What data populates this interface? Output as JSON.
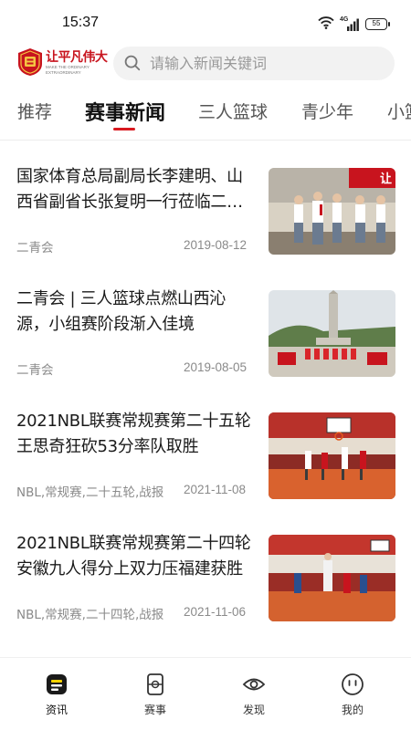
{
  "status_bar": {
    "time": "15:37",
    "network": "4G",
    "battery": "55",
    "icons": [
      "wifi-icon",
      "cellular-signal-icon",
      "battery-icon"
    ]
  },
  "header": {
    "logo_text": "让平凡伟大",
    "logo_subtitle_line1": "MAKE THE ORDINARY",
    "logo_subtitle_line2": "EXTRAORDINARY",
    "search": {
      "placeholder": "请输入新闻关键词",
      "icon": "search-icon"
    }
  },
  "tabs": [
    {
      "label": "推荐",
      "active": false
    },
    {
      "label": "赛事新闻",
      "active": true
    },
    {
      "label": "三人篮球",
      "active": false
    },
    {
      "label": "青少年",
      "active": false
    },
    {
      "label": "小篮球",
      "active": false
    }
  ],
  "news": [
    {
      "title": "国家体育总局副局长李建明、山西省副省长张复明一行莅临二青会三人篮球赛场检查指导",
      "tag": "二青会",
      "date": "2019-08-12",
      "thumb_caption": "让"
    },
    {
      "title": "二青会 | 三人篮球点燃山西沁源，小组赛阶段渐入佳境",
      "tag": "二青会",
      "date": "2019-08-05"
    },
    {
      "title": "2021NBL联赛常规赛第二十五轮 王思奇狂砍53分率队取胜",
      "tag": "NBL,常规赛,二十五轮,战报",
      "date": "2021-11-08"
    },
    {
      "title": "2021NBL联赛常规赛第二十四轮  安徽九人得分上双力压福建获胜",
      "tag": "NBL,常规赛,二十四轮,战报",
      "date": "2021-11-06"
    }
  ],
  "bottom_nav": [
    {
      "label": "资讯",
      "icon": "news-icon",
      "active": true
    },
    {
      "label": "赛事",
      "icon": "match-icon",
      "active": false
    },
    {
      "label": "发现",
      "icon": "eye-icon",
      "active": false
    },
    {
      "label": "我的",
      "icon": "profile-face-icon",
      "active": false
    }
  ],
  "colors": {
    "accent": "#d8191f",
    "brand": "#c8141e",
    "text": "#1a1a1a",
    "muted": "#8a8a8a"
  }
}
